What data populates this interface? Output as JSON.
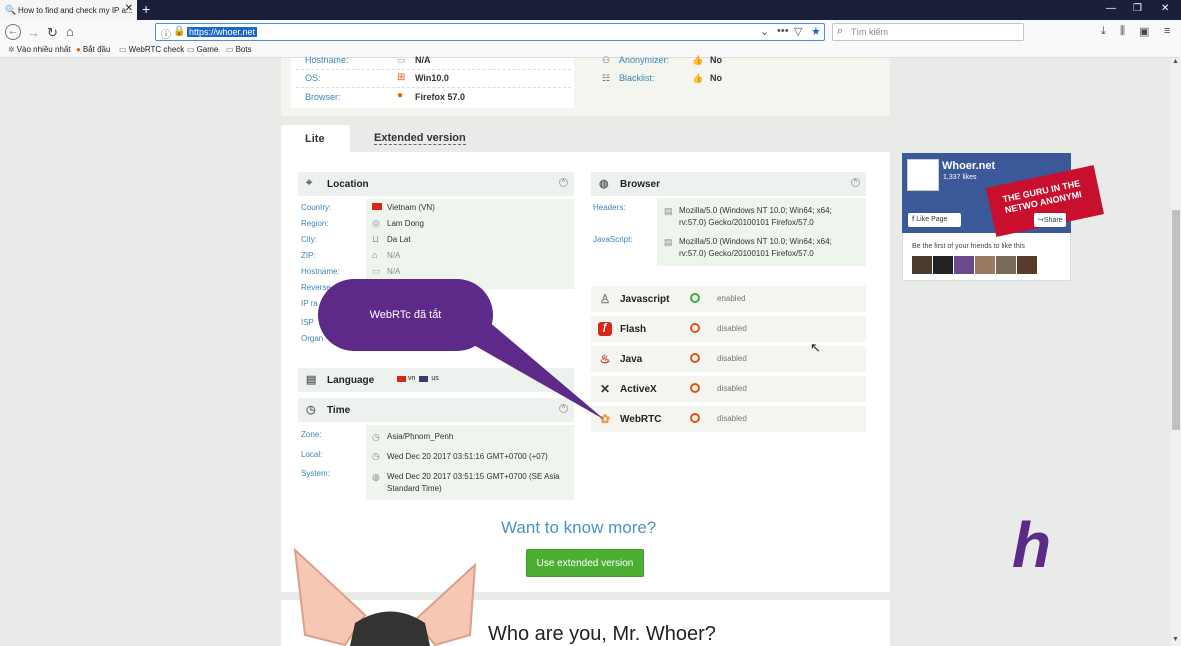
{
  "browser": {
    "tab_title": "How to find and check my IP a...",
    "url": "https://whoer.net",
    "search_placeholder": "Tìm kiếm",
    "bookmarks": [
      "Vào nhiều nhất",
      "Bắt đầu",
      "WebRTC check",
      "Game",
      "Bots"
    ]
  },
  "top_info": {
    "left": [
      {
        "label": "Hostname:",
        "value": "N/A"
      },
      {
        "label": "OS:",
        "value": "Win10.0"
      },
      {
        "label": "Browser:",
        "value": "Firefox 57.0"
      }
    ],
    "right": [
      {
        "label": "Anonymizer:",
        "value": "No"
      },
      {
        "label": "Blacklist:",
        "value": "No"
      }
    ]
  },
  "tabs": {
    "lite": "Lite",
    "extended": "Extended version"
  },
  "location": {
    "title": "Location",
    "rows": [
      {
        "label": "Country:",
        "value": "Vietnam (VN)"
      },
      {
        "label": "Region:",
        "value": "Lam Dong"
      },
      {
        "label": "City:",
        "value": "Da Lat"
      },
      {
        "label": "ZIP:",
        "value": "N/A"
      },
      {
        "label": "Hostname:",
        "value": "N/A"
      },
      {
        "label": "Reverse",
        "value": ""
      },
      {
        "label": "IP ra",
        "value": ""
      },
      {
        "label": "ISP",
        "value": ""
      },
      {
        "label": "Organ",
        "value": ""
      }
    ]
  },
  "language": {
    "title": "Language",
    "value": "vn us"
  },
  "time": {
    "title": "Time",
    "rows": [
      {
        "label": "Zone:",
        "value": "Asia/Phnom_Penh"
      },
      {
        "label": "Local:",
        "value": "Wed Dec 20 2017 03:51:16 GMT+0700 (+07)"
      },
      {
        "label": "System:",
        "value": "Wed Dec 20 2017 03:51:15 GMT+0700 (SE Asia Standard Time)"
      }
    ]
  },
  "browser_section": {
    "title": "Browser",
    "headers_label": "Headers:",
    "headers_value": "Mozilla/5.0 (Windows NT 10.0; Win64; x64; rv:57.0) Gecko/20100101 Firefox/57.0",
    "js_label": "JavaScript:",
    "js_value": "Mozilla/5.0 (Windows NT 10.0; Win64; x64; rv:57.0) Gecko/20100101 Firefox/57.0"
  },
  "plugins": [
    {
      "name": "Javascript",
      "status": "enabled",
      "color": "#3cb043"
    },
    {
      "name": "Flash",
      "status": "disabled",
      "color": "#e0531b"
    },
    {
      "name": "Java",
      "status": "disabled",
      "color": "#e0531b"
    },
    {
      "name": "ActiveX",
      "status": "disabled",
      "color": "#e0531b"
    },
    {
      "name": "WebRTC",
      "status": "disabled",
      "color": "#e0531b"
    }
  ],
  "facebook": {
    "name": "Whoer.net",
    "likes": "1,337 likes",
    "banner": "THE GURU IN THE NETWO ANONYMI",
    "like_btn": "Like Page",
    "share_btn": "Share",
    "friends_text": "Be the first of your friends to like this"
  },
  "want_more": "Want to know more?",
  "extended_btn": "Use extended version",
  "who_title": "Who are you, Mr. Whoer?",
  "callout": "WebRTc đã tắt",
  "logo_letter": "h"
}
